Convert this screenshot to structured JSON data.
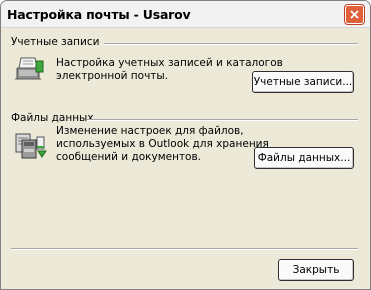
{
  "window": {
    "title": "Настройка почты - Usarov"
  },
  "accounts": {
    "section_label": "Учетные записи",
    "description_lines": [
      "Настройка учетных записей и каталогов",
      "электронной почты."
    ],
    "button_label": "Учетные записи..."
  },
  "data_files": {
    "section_label": "Файлы данных",
    "description_lines": [
      "Изменение настроек для файлов,",
      "используемых в Outlook для хранения",
      "сообщений и документов."
    ],
    "button_label": "Файлы данных..."
  },
  "footer": {
    "close_label": "Закрыть"
  },
  "icons": {
    "title_close": "close-icon",
    "accounts": "mail-accounts-icon",
    "data_files": "data-files-icon"
  }
}
